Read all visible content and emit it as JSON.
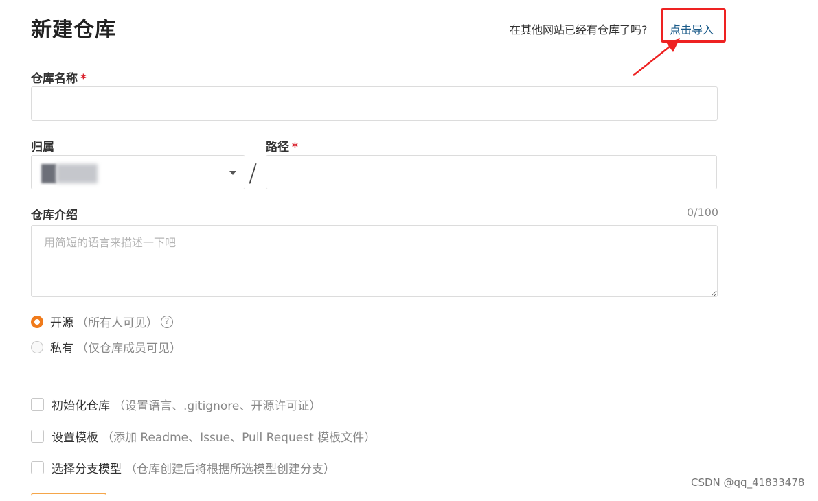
{
  "page": {
    "title": "新建仓库",
    "import_question": "在其他网站已经有仓库了吗?",
    "import_link": "点击导入"
  },
  "form": {
    "repo_name": {
      "label": "仓库名称",
      "required_mark": "*",
      "value": ""
    },
    "owner": {
      "label": "归属",
      "selected": ""
    },
    "path": {
      "label": "路径",
      "required_mark": "*",
      "value": ""
    },
    "separator": "/",
    "description": {
      "label": "仓库介绍",
      "counter": "0/100",
      "placeholder": "用简短的语言来描述一下吧",
      "value": ""
    },
    "visibility": [
      {
        "label": "开源",
        "note": "（所有人可见）",
        "checked": true,
        "help_icon": "question-circle-icon",
        "help_glyph": "?"
      },
      {
        "label": "私有",
        "note": "（仅仓库成员可见）",
        "checked": false
      }
    ],
    "options": [
      {
        "label": "初始化仓库",
        "note": "（设置语言、.gitignore、开源许可证）",
        "checked": false
      },
      {
        "label": "设置模板",
        "note": "（添加 Readme、Issue、Pull Request 模板文件）",
        "checked": false
      },
      {
        "label": "选择分支模型",
        "note": "（仓库创建后将根据所选模型创建分支）",
        "checked": false
      }
    ]
  },
  "watermark": "CSDN @qq_41833478",
  "colors": {
    "accent": "#f07b1b",
    "link": "#1c5c8a",
    "required": "#d9232e",
    "annotation": "#ee2222"
  }
}
